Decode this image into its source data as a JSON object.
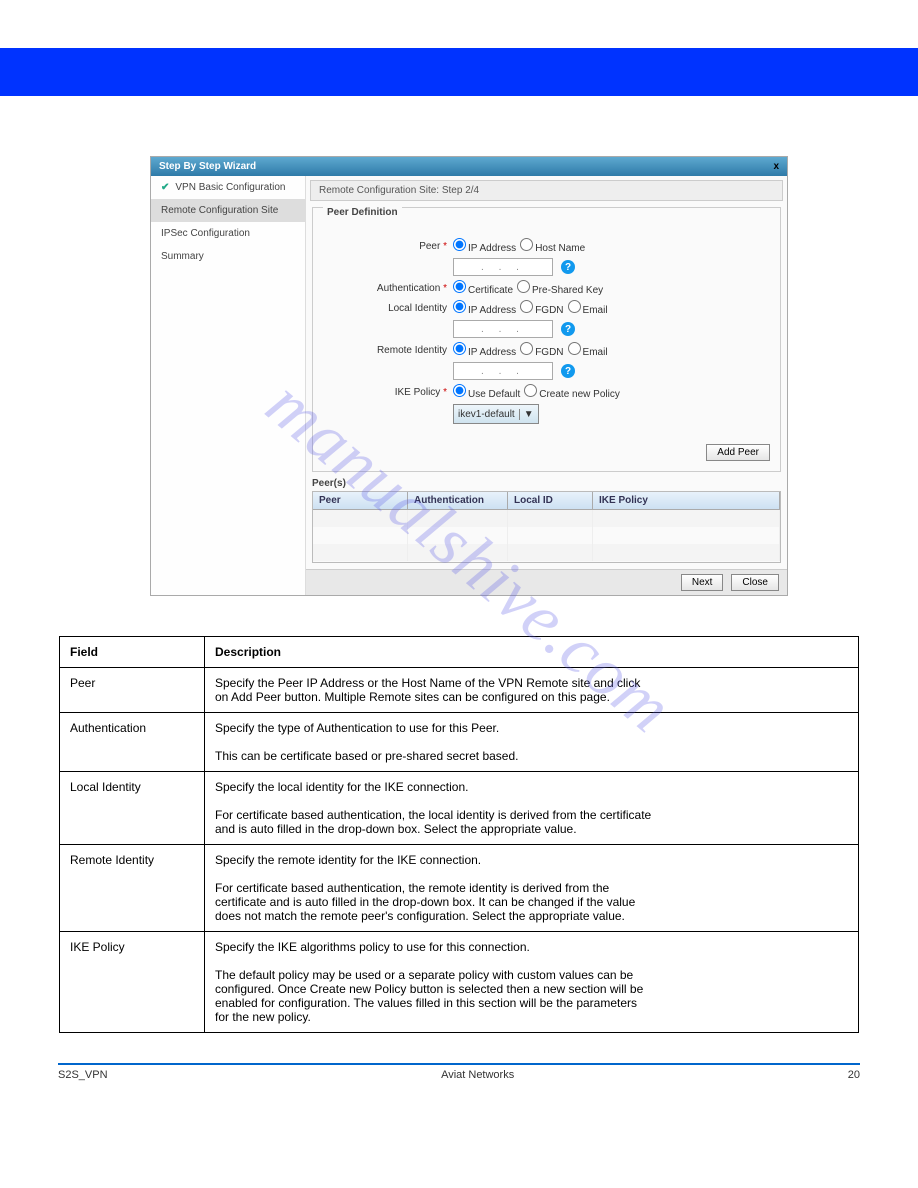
{
  "banner": {
    "left": "",
    "right": ""
  },
  "wizard": {
    "title": "Step By Step Wizard",
    "close": "x",
    "sidebar": {
      "s0": "VPN Basic Configuration",
      "s1": "Remote Configuration Site",
      "s2": "IPSec Configuration",
      "s3": "Summary"
    },
    "step_header": "Remote Configuration Site: Step 2/4",
    "fieldset_legend": "Peer Definition",
    "labels": {
      "peer": "Peer",
      "auth": "Authentication",
      "local_id": "Local Identity",
      "remote_id": "Remote Identity",
      "ike_policy": "IKE Policy"
    },
    "options": {
      "ip_address": "IP Address",
      "host_name": "Host Name",
      "certificate": "Certificate",
      "pre_shared": "Pre-Shared Key",
      "fgdn": "FGDN",
      "email": "Email",
      "use_default": "Use Default",
      "create_new": "Create new Policy"
    },
    "ike_select": "ikev1-default",
    "add_peer": "Add Peer",
    "peers_title": "Peer(s)",
    "peers_headers": {
      "peer": "Peer",
      "auth": "Authentication",
      "lid": "Local ID",
      "ike": "IKE Policy"
    },
    "footer": {
      "next": "Next",
      "close": "Close"
    }
  },
  "table": {
    "h_field": "Field",
    "h_desc": "Description",
    "rows": [
      {
        "f": "Peer",
        "d": "Specify the Peer IP Address or the Host Name of the VPN Remote site and click\non Add Peer button. Multiple Remote sites can be configured on this page."
      },
      {
        "f": "Authentication",
        "d": "Specify the type of Authentication to use for this Peer.\n\nThis can be certificate based or pre-shared secret based."
      },
      {
        "f": "Local Identity",
        "d": "Specify the local identity for the IKE connection.\n\nFor certificate based authentication, the local identity is derived from the certificate\nand is auto filled in the drop-down box. Select the appropriate value."
      },
      {
        "f": "Remote Identity",
        "d": "Specify the remote identity for the IKE connection.\n\nFor certificate based authentication, the remote identity is derived from the\ncertificate and is auto filled in the drop-down box. It can be changed if the value\ndoes not match the remote peer's configuration. Select the appropriate value."
      },
      {
        "f": "IKE Policy",
        "d": "Specify the IKE algorithms policy to use for this connection.\n\nThe default policy may be used or a separate policy with custom values can be\nconfigured. Once Create new Policy button is selected then a new section will be\nenabled for configuration. The values filled in this section will be the parameters\nfor the new policy."
      }
    ]
  },
  "footer": {
    "left": "S2S_VPN",
    "mid": "Aviat Networks",
    "right": "20"
  },
  "watermark": "manualshive.com"
}
